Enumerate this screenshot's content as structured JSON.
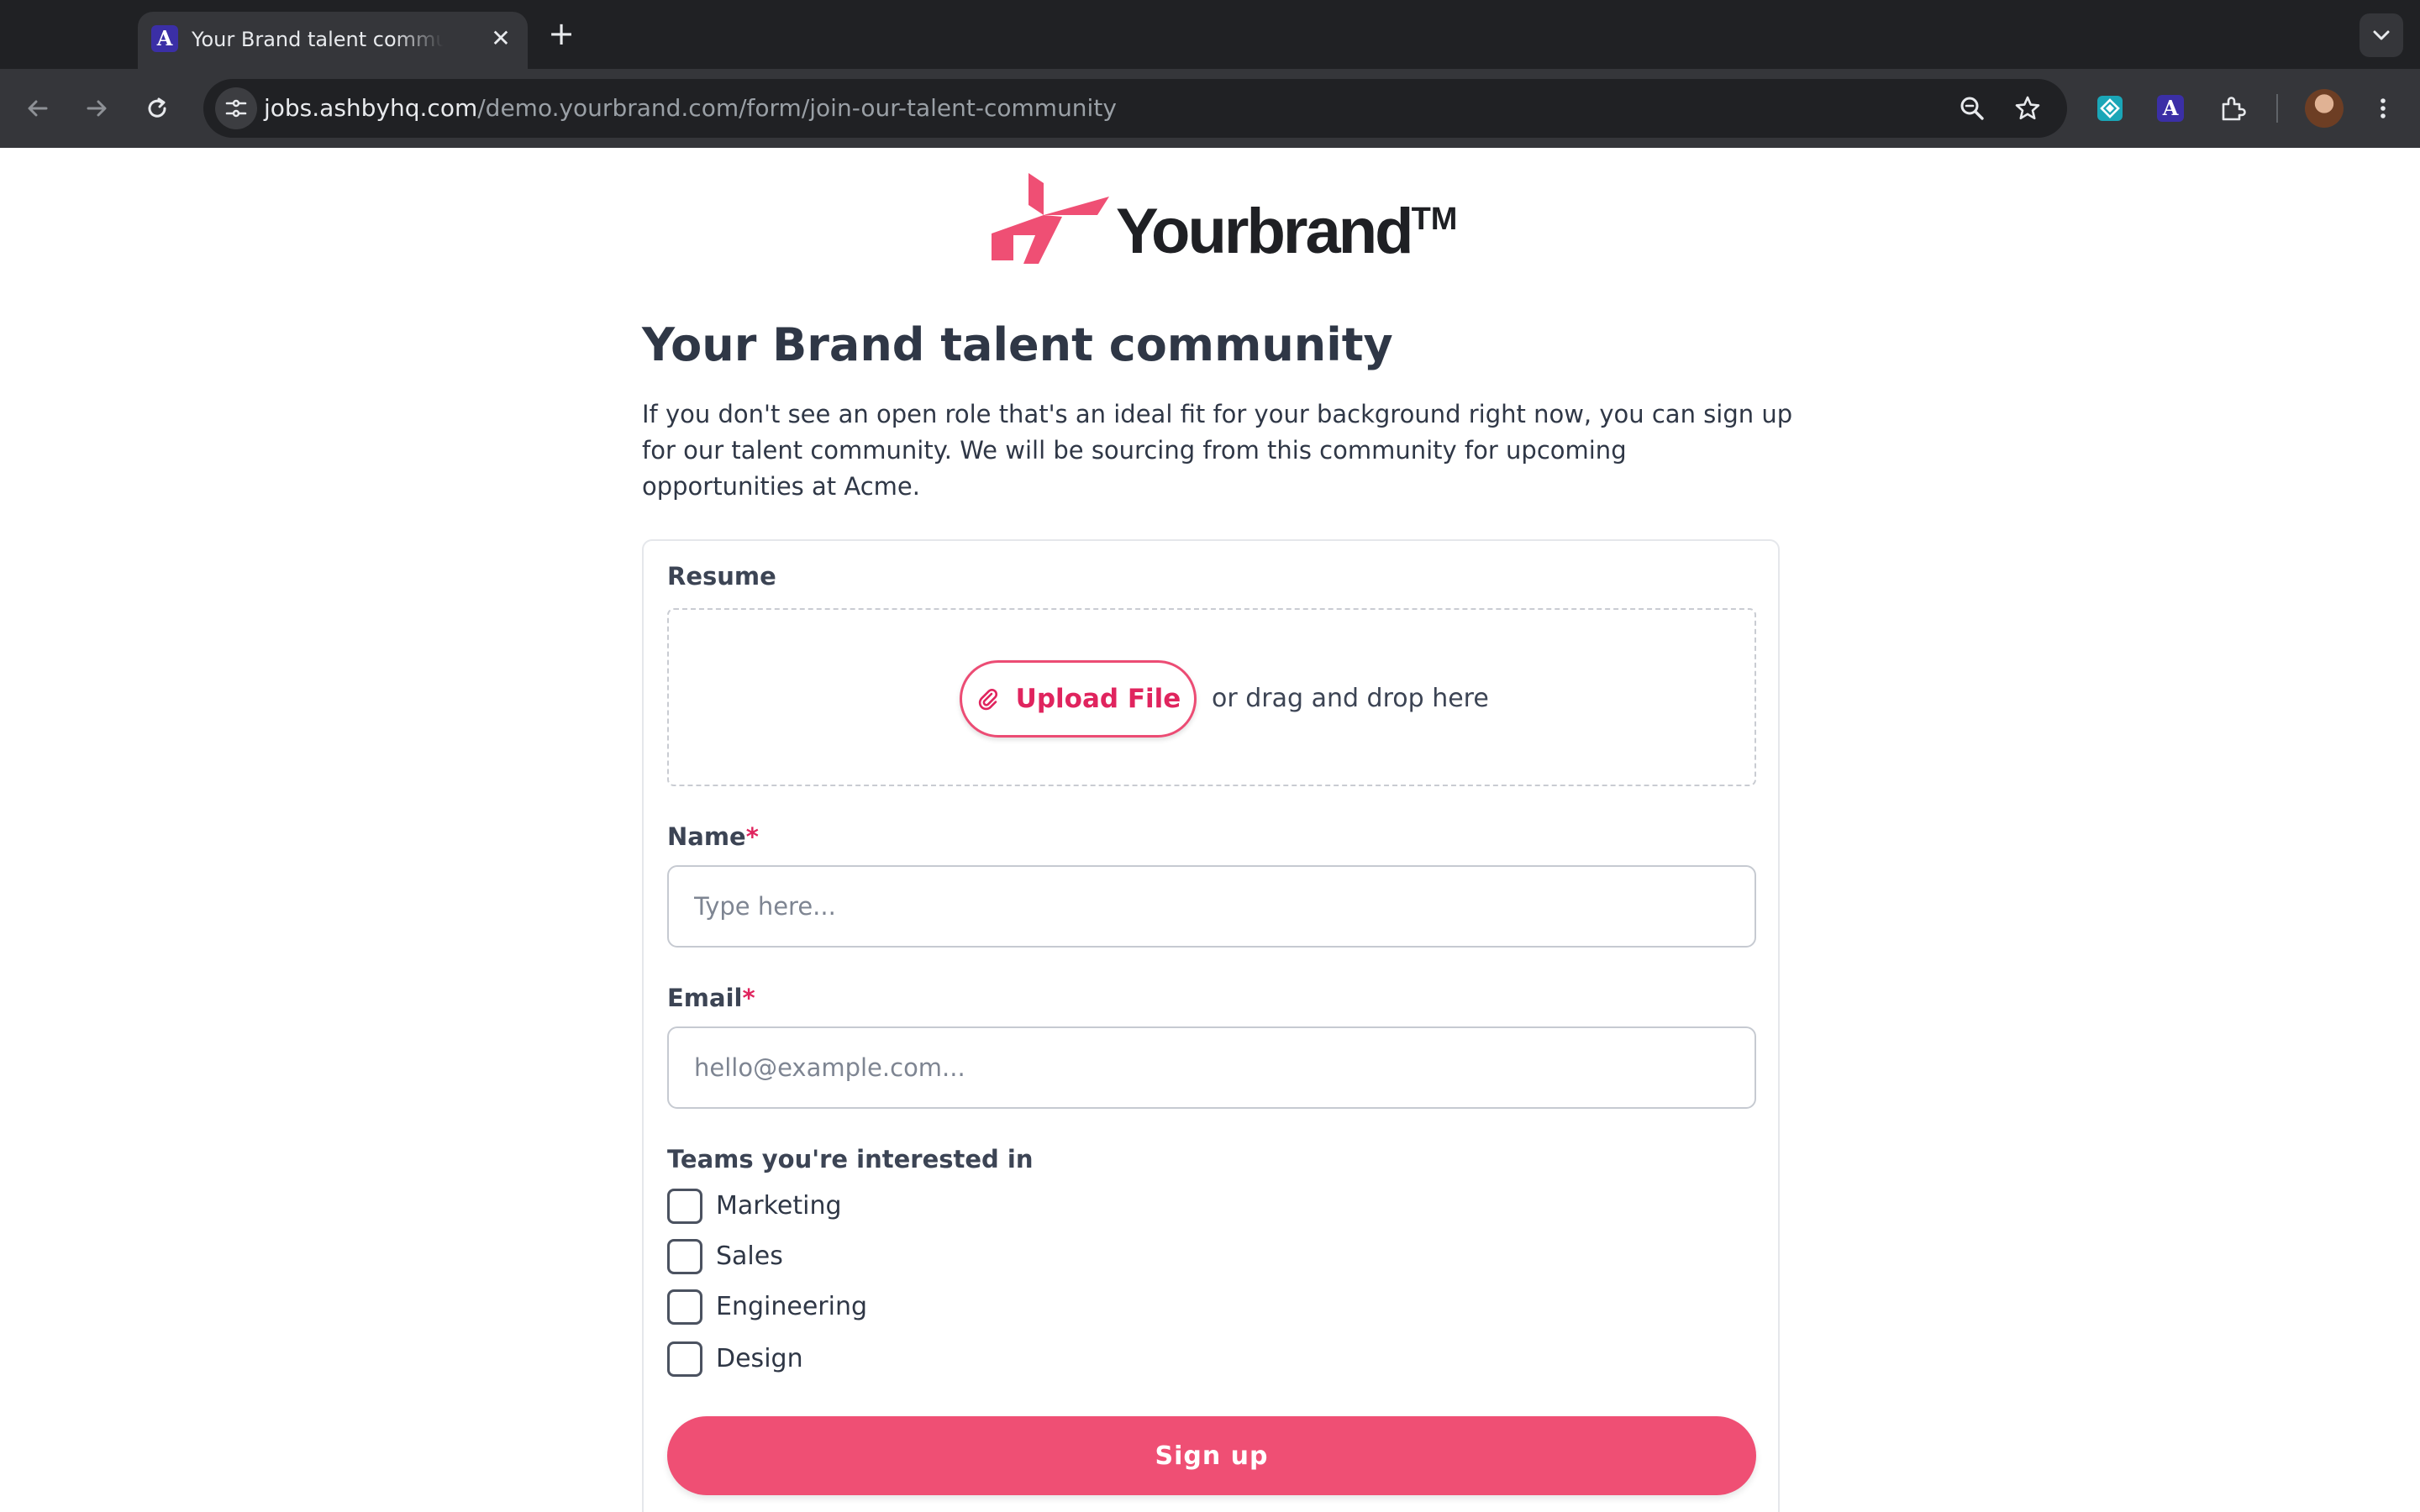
{
  "browser": {
    "tab_title": "Your Brand talent community",
    "tab_favicon_letter": "A",
    "url_host": "jobs.ashbyhq.com",
    "url_path": "/demo.yourbrand.com/form/join-our-talent-community",
    "extension_letter": "A",
    "icons": [
      "back-icon",
      "forward-icon",
      "reload-icon",
      "site-info-icon",
      "zoom-icon",
      "bookmark-star-icon",
      "extensions-icon",
      "menu-icon",
      "tab-search-icon",
      "new-tab-icon",
      "close-icon"
    ]
  },
  "brand": {
    "name": "Yourbrand",
    "trademark": "TM",
    "color": "#ef4f74"
  },
  "page": {
    "title": "Your Brand talent community",
    "description": "If you don't see an open role that's an ideal fit for your background right now, you can sign up for our talent community. We will be sourcing from this community for upcoming opportunities at Acme."
  },
  "form": {
    "resume": {
      "label": "Resume",
      "upload_label": "Upload File",
      "drag_hint": "or drag and drop here"
    },
    "name": {
      "label": "Name",
      "required_mark": "*",
      "placeholder": "Type here..."
    },
    "email": {
      "label": "Email",
      "required_mark": "*",
      "placeholder": "hello@example.com..."
    },
    "teams": {
      "label": "Teams you're interested in",
      "options": [
        {
          "label": "Marketing",
          "checked": false
        },
        {
          "label": "Sales",
          "checked": false
        },
        {
          "label": "Engineering",
          "checked": false
        },
        {
          "label": "Design",
          "checked": false
        }
      ]
    },
    "submit_label": "Sign up"
  }
}
